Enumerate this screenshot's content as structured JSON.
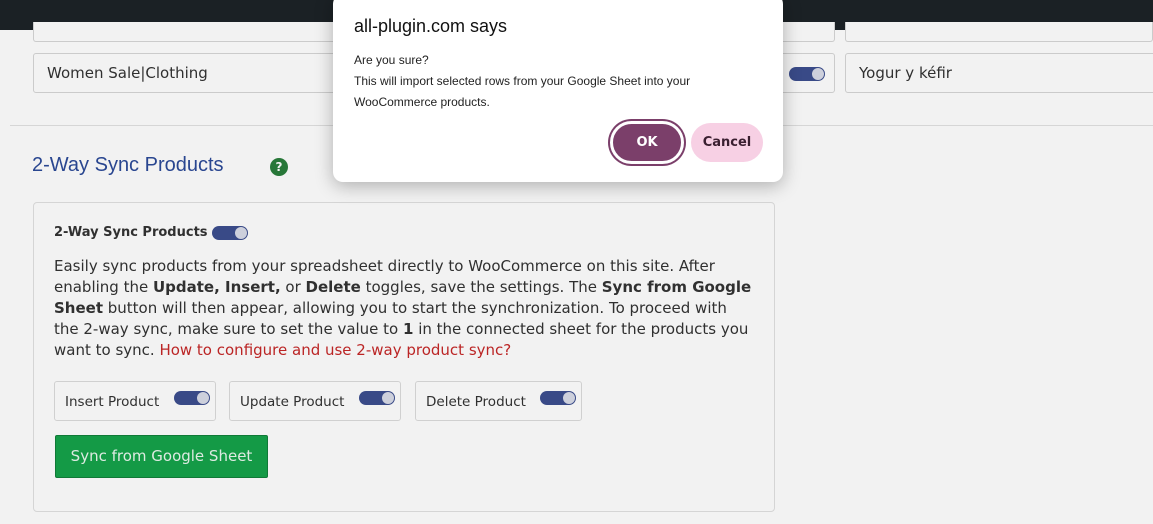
{
  "top_row": {
    "category_value": "Women Sale|Clothing",
    "name_value": "Yogur y kéfir"
  },
  "section": {
    "title": "2-Way Sync Products",
    "help_icon": "?"
  },
  "card": {
    "toggle_label": "2-Way Sync Products",
    "desc": {
      "t1": "Easily sync products from your spreadsheet directly to WooCommerce on this site. After enabling the ",
      "b1": "Update, Insert,",
      "t2": " or ",
      "b2": "Delete",
      "t3": " toggles, save the settings. The ",
      "b3": "Sync from Google Sheet",
      "t4": " button will then appear, allowing you to start the synchronization. To proceed with the 2-way sync, make sure to set the value to ",
      "b4": "1",
      "t5": " in the connected sheet for the products you want to sync. ",
      "link": "How to configure and use 2-way product sync?"
    },
    "options": [
      {
        "label": "Insert Product"
      },
      {
        "label": "Update Product"
      },
      {
        "label": "Delete Product"
      }
    ],
    "sync_button": "Sync from Google Sheet"
  },
  "dialog": {
    "title": "all-plugin.com says",
    "line1": "Are you sure?",
    "line2": "This will import selected rows from your Google Sheet into your WooCommerce products.",
    "ok": "OK",
    "cancel": "Cancel"
  },
  "colors": {
    "accent": "#2c4a98",
    "toggle": "#3d4f8f",
    "sync_button": "#16a34a",
    "ok_button": "#7b3f6a",
    "cancel_button": "#f7d0e4",
    "link": "#c62828"
  }
}
